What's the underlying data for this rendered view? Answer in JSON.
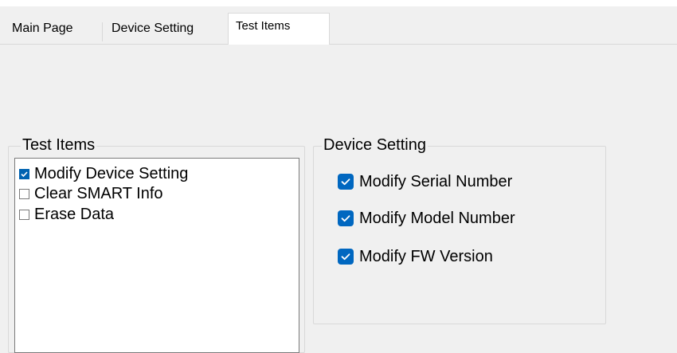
{
  "tabs": [
    {
      "label": "Main Page",
      "active": false
    },
    {
      "label": "Device Setting",
      "active": false
    },
    {
      "label": "Test Items",
      "active": true
    }
  ],
  "test_items": {
    "title": "Test Items",
    "items": [
      {
        "label": "Modify Device Setting",
        "checked": true
      },
      {
        "label": "Clear SMART Info",
        "checked": false
      },
      {
        "label": "Erase Data",
        "checked": false
      }
    ]
  },
  "device_setting": {
    "title": "Device Setting",
    "options": [
      {
        "label": "Modify Serial Number",
        "checked": true
      },
      {
        "label": "Modify Model Number",
        "checked": true
      },
      {
        "label": "Modify FW Version",
        "checked": true
      }
    ]
  },
  "colors": {
    "window_bg": "#f0f0f0",
    "check_accent": "#0067c0"
  }
}
